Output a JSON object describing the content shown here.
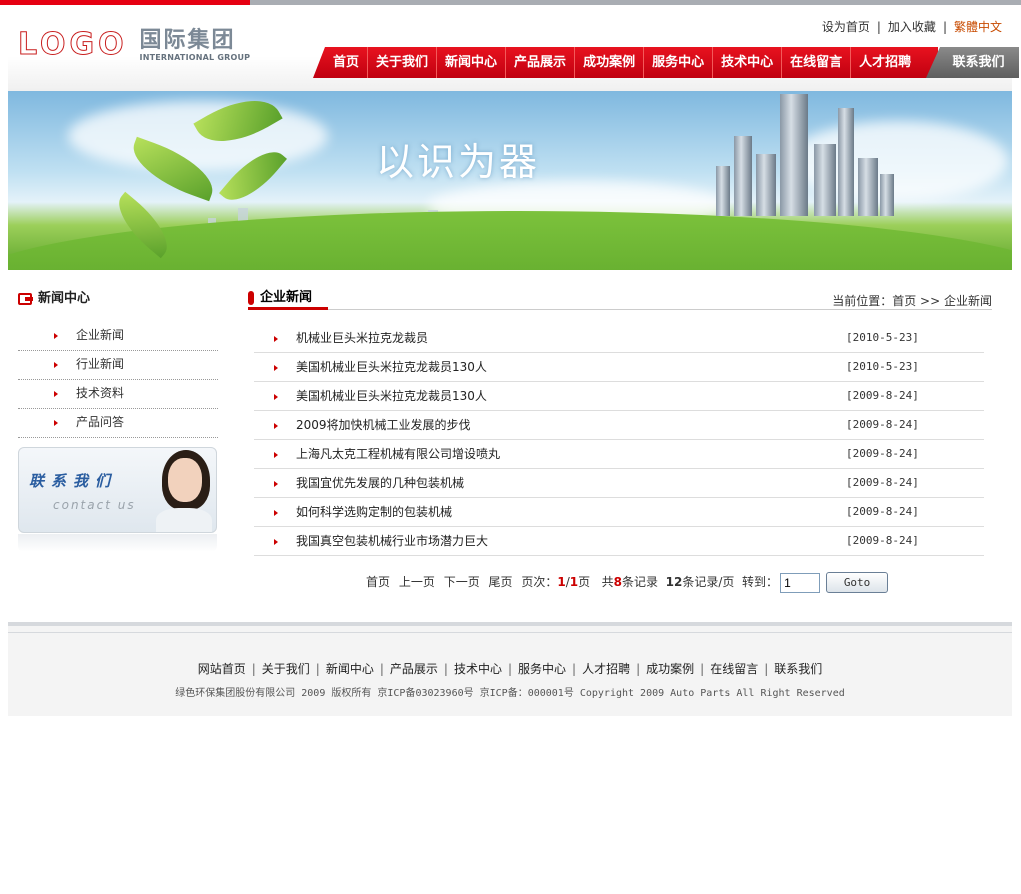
{
  "header": {
    "logo_mark": "LOGO",
    "logo_cn": "国际集团",
    "logo_en": "INTERNATIONAL GROUP",
    "toplinks": {
      "homepage": "设为首页",
      "bookmark": "加入收藏",
      "traditional": "繁體中文"
    }
  },
  "nav": {
    "items": [
      "首页",
      "关于我们",
      "新闻中心",
      "产品展示",
      "成功案例",
      "服务中心",
      "技术中心",
      "在线留言",
      "人才招聘"
    ],
    "contact": "联系我们"
  },
  "banner": {
    "slogan": "以识为器"
  },
  "sidebar": {
    "title": "新闻中心",
    "items": [
      "企业新闻",
      "行业新闻",
      "技术资料",
      "产品问答"
    ],
    "contact_cn": "联系我们",
    "contact_en": "contact us"
  },
  "main": {
    "title": "企业新闻",
    "breadcrumb": {
      "prefix": "当前位置：",
      "home": "首页",
      "sep": ">>",
      "current": "企业新闻"
    },
    "news": [
      {
        "title": "机械业巨头米拉克龙裁员",
        "date": "[2010-5-23]"
      },
      {
        "title": "美国机械业巨头米拉克龙裁员130人",
        "date": "[2010-5-23]"
      },
      {
        "title": "美国机械业巨头米拉克龙裁员130人",
        "date": "[2009-8-24]"
      },
      {
        "title": "2009将加快机械工业发展的步伐",
        "date": "[2009-8-24]"
      },
      {
        "title": "上海凡太克工程机械有限公司增设喷丸",
        "date": "[2009-8-24]"
      },
      {
        "title": "我国宜优先发展的几种包装机械",
        "date": "[2009-8-24]"
      },
      {
        "title": "如何科学选购定制的包装机械",
        "date": "[2009-8-24]"
      },
      {
        "title": "我国真空包装机械行业市场潜力巨大",
        "date": "[2009-8-24]"
      }
    ],
    "pager": {
      "first": "首页",
      "prev": "上一页",
      "next": "下一页",
      "last": "尾页",
      "page_label": "页次：",
      "current_page": "1",
      "slash": "/",
      "total_pages": "1",
      "page_suffix": "页",
      "total_prefix": "共",
      "total_records": "8",
      "total_suffix": "条记录",
      "per_page": "12",
      "per_page_suffix": "条记录/页",
      "goto_label": "转到：",
      "goto_value": "1",
      "goto_button": "Goto"
    }
  },
  "footer": {
    "links": [
      "网站首页",
      "关于我们",
      "新闻中心",
      "产品展示",
      "技术中心",
      "服务中心",
      "人才招聘",
      "成功案例",
      "在线留言",
      "联系我们"
    ],
    "copyright": "绿色环保集团股份有限公司 2009 版权所有 京ICP备03023960号 京ICP备：000001号 Copyright 2009 Auto Parts All Right Reserved"
  }
}
